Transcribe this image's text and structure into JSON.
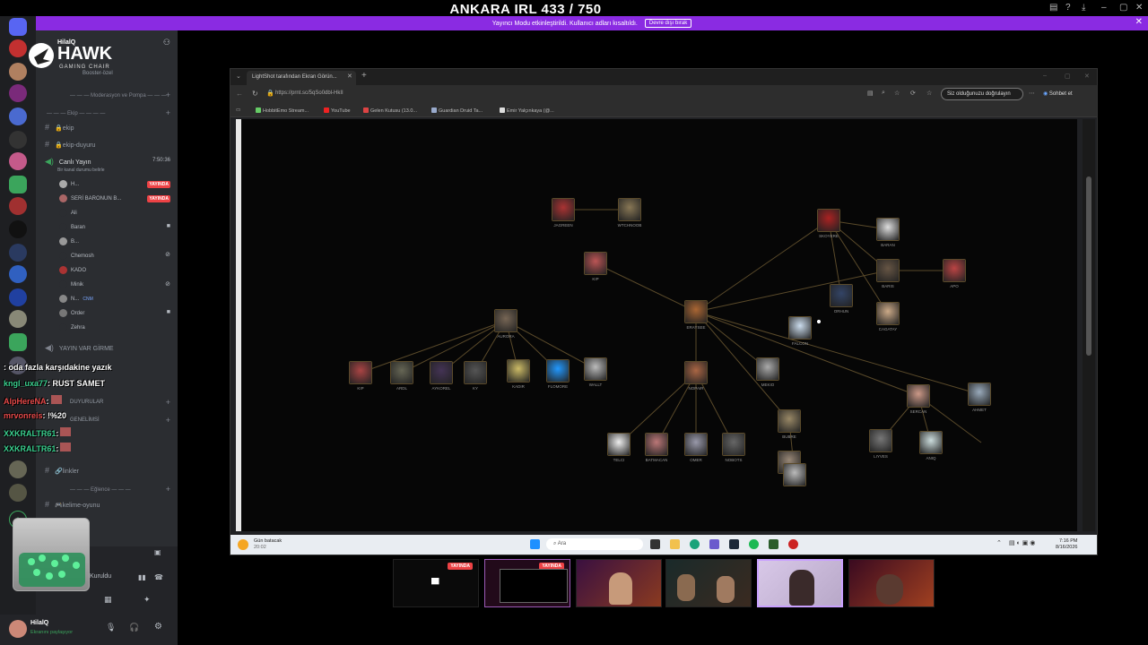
{
  "top": {
    "title": "ANKARA IRL 433 / 750",
    "banner_text": "Yayıncı Modu etkinleştirildi. Kullanıcı adları kısaltıldı.",
    "banner_button": "Devre dışı bırak"
  },
  "server": {
    "name": "HilalQ",
    "brand_line1": "HAWK",
    "brand_line2": "GAMING CHAIR"
  },
  "sidebar": {
    "booster": "Booster-özel",
    "cat_moderation": "— — — Moderasyon ve Pompa — — —",
    "cat_ekip": "— — — Ekip — — — —",
    "ch_ekip": "ekip",
    "ch_ekip_duyuru": "ekip-duyuru",
    "voice_channel": "Canlı Yayın",
    "voice_timer": "7:50:36",
    "voice_status": "Bir kanal durumu belirle",
    "voice_users": [
      "H...",
      "SERİ BARONUN B...",
      "Ali",
      "Baran",
      "B...",
      "Chemosh",
      "KADO",
      "Minik",
      "N...",
      "Order",
      "Zehra"
    ],
    "live_badge": "YAYINDA",
    "cnm_tag": "CNM",
    "ch_yayin_var": "YAYIN VAR GİRME",
    "ch_duyurular": "DUYURULAR",
    "ch_genel": "GENELİMSİ",
    "ch_linkler": "linkler",
    "cat_eglence": "— — — Eğlence — — —",
    "ch_kelime": "kelime-oyunu",
    "voice_connected": "Kuruldu"
  },
  "chat": [
    {
      "user": "",
      "message": ": oda fazla karşıdakine yazık"
    },
    {
      "user": "kngl_uxa77",
      "message": ": RUST SAMET"
    },
    {
      "user": "AlpHereNA",
      "message": ":"
    },
    {
      "user": "mrvonreis",
      "message": ": !%20"
    },
    {
      "user": "XXKRALTR61",
      "message": ":"
    },
    {
      "user": "XXKRALTR61",
      "message": ":"
    }
  ],
  "user_panel": {
    "name": "HilalQ",
    "status": "Ekranını paylaşıyor"
  },
  "browser": {
    "tab_title": "LightShot tarafından Ekran Görün...",
    "url": "https://prnt.sc/5qSo0dbl-HkII",
    "verify": "Siz olduğunuzu doğrulayın",
    "chat_label": "Sohbet et",
    "bookmarks": [
      "HobbitEmo Stream...",
      "YouTube",
      "Gelen Kutusu (13.0...",
      "Guardian Druid Ta...",
      "Emir Yalçınkaya (@..."
    ]
  },
  "taskbar": {
    "weather": "Gün batacak",
    "weather_sub": "20:02",
    "search_placeholder": "Ara",
    "time": "7:16 PM",
    "date": "8/16/2026"
  },
  "diagram": {
    "nodes": [
      "JAGREEN",
      "WTCHNOOB",
      "KIP",
      "SKOYERE",
      "BARAN",
      "APO",
      "BARIS",
      "ORHUN",
      "CAGATAY",
      "FALCON",
      "ERAYSEE",
      "AURORA",
      "KIP",
      "ARDL",
      "AYKOREL",
      "KY",
      "KADIR",
      "FLOMORE",
      "WALLT",
      "NOPAIR",
      "MEKIO",
      "SERCAN",
      "AHMET",
      "BUBRE",
      "TELCI",
      "BATMACAN",
      "OMER",
      "NOBOTS",
      "MAHIR",
      "",
      "LIYVES",
      "ANIQ"
    ]
  },
  "thumbs": {
    "live_badge": "YAYINDA"
  }
}
